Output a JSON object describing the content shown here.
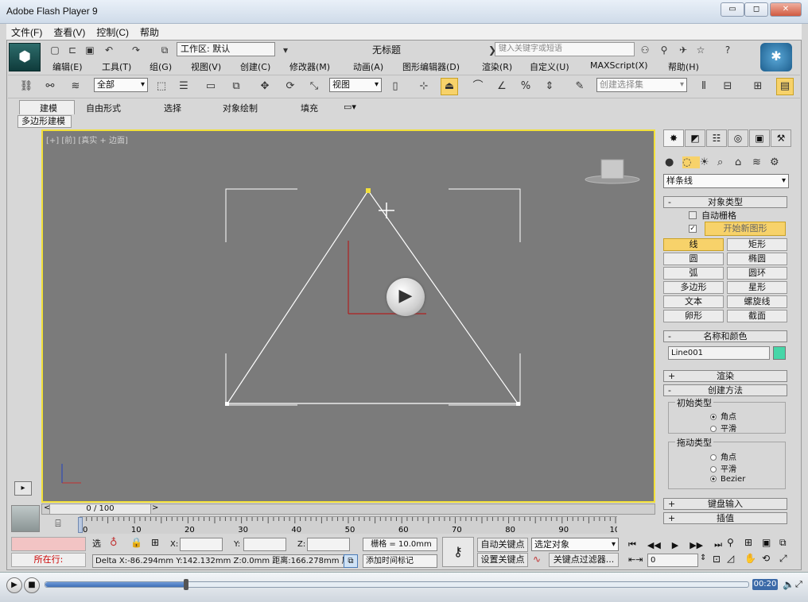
{
  "window": {
    "title": "Adobe Flash Player 9",
    "controls": {
      "minimize": "▭",
      "restore": "◻",
      "close": "✕"
    }
  },
  "menubar": [
    "文件(F)",
    "查看(V)",
    "控制(C)",
    "帮助"
  ],
  "app": {
    "workspace": "工作区: 默认",
    "document_title": "无标题",
    "search_placeholder": "键入关键字或短语",
    "menus": [
      "编辑(E)",
      "工具(T)",
      "组(G)",
      "视图(V)",
      "创建(C)",
      "修改器(M)",
      "动画(A)",
      "图形编辑器(D)",
      "渲染(R)",
      "自定义(U)",
      "MAXScript(X)",
      "帮助(H)"
    ]
  },
  "toolbar": {
    "selection_filter": "全部",
    "reference_coord": "视图",
    "named_selection_placeholder": "创建选择集"
  },
  "ribbon": {
    "tabs": [
      "建模",
      "自由形式",
      "选择",
      "对象绘制",
      "填充"
    ],
    "subtab": "多边形建模"
  },
  "viewport": {
    "label": "[+] [前] [真实 + 边面]"
  },
  "command_panel": {
    "category": "样条线",
    "object_type": {
      "header": "对象类型",
      "auto_grid": "自动栅格",
      "start_new_shape": "开始新图形",
      "buttons": [
        "线",
        "矩形",
        "圆",
        "椭圆",
        "弧",
        "圆环",
        "多边形",
        "星形",
        "文本",
        "螺旋线",
        "卵形",
        "截面"
      ]
    },
    "name_color": {
      "header": "名称和颜色",
      "name": "Line001",
      "color": "#46d6a8"
    },
    "rollouts": {
      "render": "渲染",
      "creation_method": "创建方法",
      "keyboard_entry": "键盘输入",
      "interpolation": "插值"
    },
    "initial_type": {
      "title": "初始类型",
      "options": [
        "角点",
        "平滑"
      ],
      "selected": "角点"
    },
    "drag_type": {
      "title": "拖动类型",
      "options": [
        "角点",
        "平滑",
        "Bezier"
      ],
      "selected": "Bezier"
    }
  },
  "timeline": {
    "slider": "0 / 100",
    "ticks": [
      "0",
      "10",
      "20",
      "30",
      "40",
      "50",
      "60",
      "70",
      "80",
      "90",
      "100"
    ]
  },
  "status": {
    "row_label": "所在行:",
    "x_label": "X:",
    "y_label": "Y:",
    "z_label": "Z:",
    "grid": "栅格 = 10.0mm",
    "delta": "Delta X:-86.294mm  Y:142.132mm  Z:0.0mm  距离:166.278mm 屏",
    "add_time_tag": "添加时间标记",
    "auto_key": "自动关键点",
    "set_key": "设置关键点",
    "selected_objects": "选定对象",
    "key_filters": "关键点过滤器...",
    "frame": "0",
    "lock_label": "选"
  },
  "player": {
    "time": "00:20",
    "progress_fraction": 0.2
  }
}
